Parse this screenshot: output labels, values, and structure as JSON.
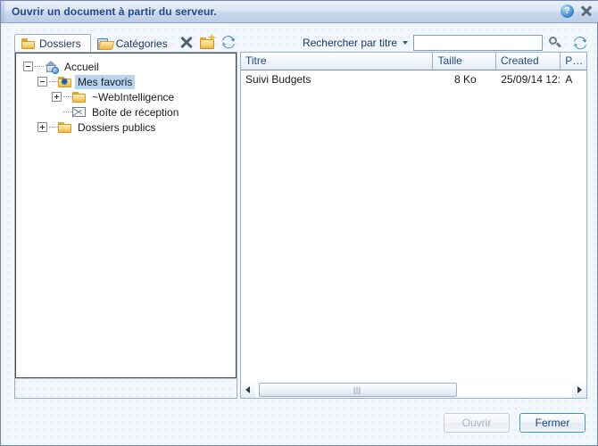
{
  "window": {
    "title": "Ouvrir un document à partir du serveur.",
    "help_icon": "help-icon",
    "close_icon": "close-icon"
  },
  "tabs": [
    {
      "label": "Dossiers",
      "icon": "folder-icon",
      "active": true
    },
    {
      "label": "Catégories",
      "icon": "folder-open-icon",
      "active": false
    }
  ],
  "tab_tools": [
    {
      "name": "delete-button",
      "icon": "x-icon"
    },
    {
      "name": "new-folder-button",
      "icon": "new-folder-icon"
    },
    {
      "name": "refresh-tree-button",
      "icon": "refresh-icon"
    }
  ],
  "search": {
    "label": "Rechercher par titre",
    "caret_icon": "chevron-down-icon",
    "value": "",
    "placeholder": "",
    "magnifier_icon": "search-icon",
    "refresh_icon": "refresh-icon"
  },
  "tree": [
    {
      "label": "Accueil",
      "icon": "home-icon",
      "depth": 0,
      "expander": "minus",
      "selected": false
    },
    {
      "label": "Mes favoris",
      "icon": "favorites-icon",
      "depth": 1,
      "expander": "minus",
      "selected": true
    },
    {
      "label": "~WebIntelligence",
      "icon": "folder-icon",
      "depth": 2,
      "expander": "plus",
      "selected": false
    },
    {
      "label": "Boîte de réception",
      "icon": "inbox-icon",
      "depth": 2,
      "expander": "none",
      "selected": false
    },
    {
      "label": "Dossiers publics",
      "icon": "folder-icon",
      "depth": 1,
      "expander": "plus",
      "selected": false
    }
  ],
  "list": {
    "columns": [
      "Titre",
      "Taille",
      "Created",
      "P…"
    ],
    "rows": [
      {
        "title": "Suivi Budgets",
        "size": "8 Ko",
        "created": "25/09/14 12:...",
        "owner": "A"
      }
    ]
  },
  "scrollbar": {
    "left_arrow_icon": "arrow-left-icon",
    "right_arrow_icon": "arrow-right-icon",
    "grip_icon": "grip-icon"
  },
  "buttons": {
    "open": "Ouvrir",
    "close": "Fermer"
  },
  "colors": {
    "accent": "#1f4a8a",
    "title_text": "#1f4a8a",
    "selection": "#b7d5f0",
    "primary_border": "#3d93cf",
    "folder": "#efb93f"
  }
}
